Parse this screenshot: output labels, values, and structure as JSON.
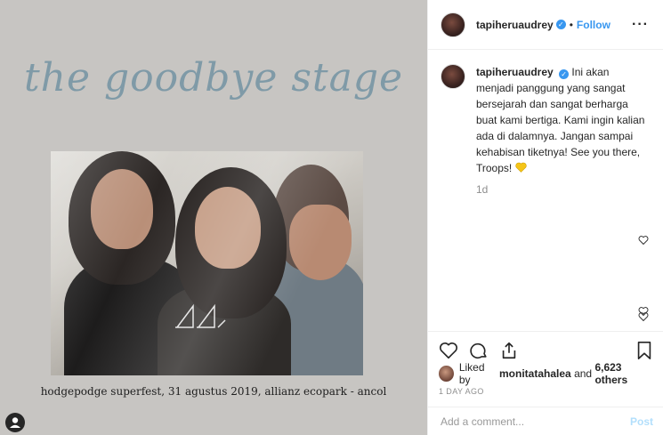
{
  "post_image": {
    "title_text": "the goodbye stage",
    "caption_text": "hodgepodge superfest, 31 agustus 2019, allianz ecopark - ancol",
    "colors": {
      "background": "#c7c5c2",
      "title": "#7f9aa7"
    }
  },
  "header": {
    "username": "tapiheruaudrey",
    "separator": "•",
    "follow_label": "Follow",
    "more_label": "···"
  },
  "caption": {
    "username": "tapiheruaudrey",
    "text": "Ini akan menjadi panggung yang sangat bersejarah dan sangat berharga buat kami bertiga. Kami ingin kalian ada di dalamnya. Jangan sampai kehabisan tiketnya! See you there, Troops!",
    "emoji": "yellow-heart",
    "time_ago": "1d"
  },
  "actions": {
    "icons": [
      "heart-icon",
      "comment-icon",
      "share-icon",
      "bookmark-icon"
    ]
  },
  "likes": {
    "prefix": "Liked by",
    "liker": "monitatahalea",
    "connector": "and",
    "others": "6,623 others"
  },
  "post_date": "1 DAY AGO",
  "comment_box": {
    "placeholder": "Add a comment...",
    "post_label": "Post"
  },
  "colors": {
    "link_blue": "#3897f0",
    "post_disabled": "#b2dffc",
    "muted": "#8e8e8e"
  }
}
